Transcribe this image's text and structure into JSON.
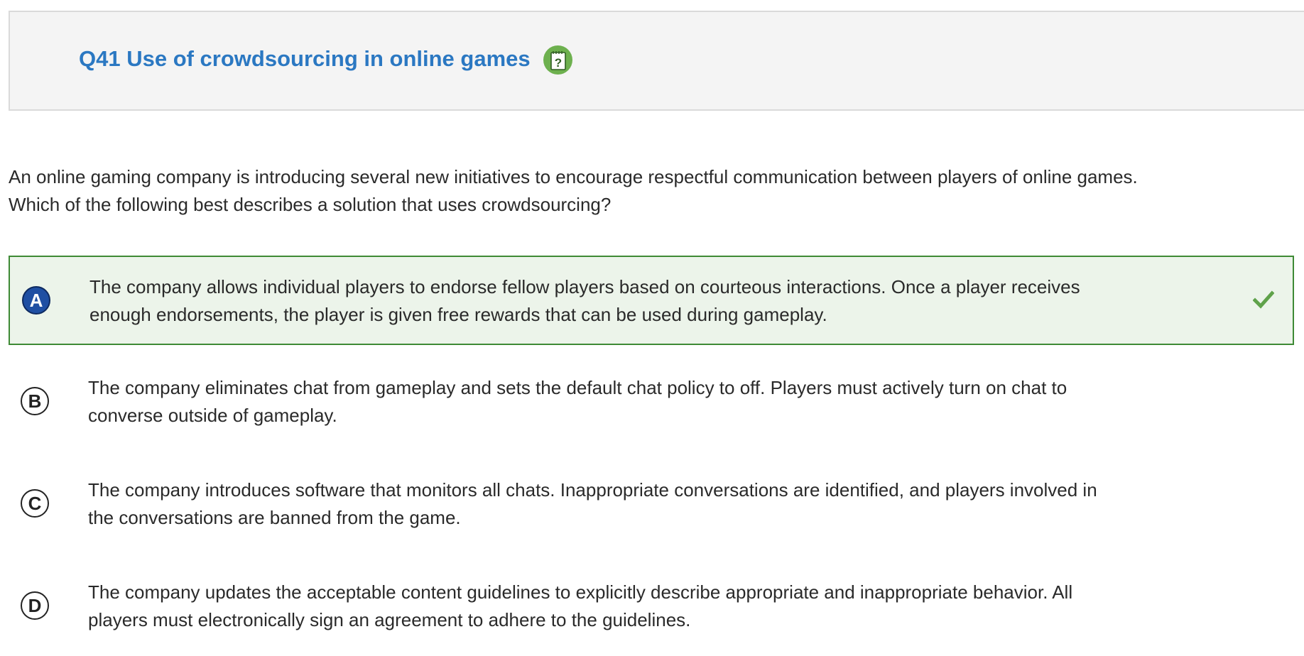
{
  "header": {
    "title": "Q41 Use of crowdsourcing in online games",
    "help_icon": "question-notepad-icon"
  },
  "question": {
    "line1": "An online gaming company is introducing several new initiatives to encourage respectful communication between players of online games.",
    "line2": "Which of the following best describes a solution that uses crowdsourcing?"
  },
  "options": [
    {
      "letter": "A",
      "text": "The company allows individual players to endorse fellow players based on courteous interactions. Once a player receives enough endorsements, the player is given free rewards that can be used during gameplay.",
      "selected": true,
      "correct": true
    },
    {
      "letter": "B",
      "text": "The company eliminates chat from gameplay and sets the default chat policy to off. Players must actively turn on chat to converse outside of gameplay.",
      "selected": false,
      "correct": false
    },
    {
      "letter": "C",
      "text": "The company introduces software that monitors all chats. Inappropriate conversations are identified, and players involved in the conversations are banned from the game.",
      "selected": false,
      "correct": false
    },
    {
      "letter": "D",
      "text": "The company updates the acceptable content guidelines to explicitly describe appropriate and inappropriate behavior. All players must electronically sign an agreement to adhere to the guidelines.",
      "selected": false,
      "correct": false
    }
  ],
  "colors": {
    "title": "#2b78c2",
    "correct_border": "#3e8a35",
    "correct_bg": "#ecf4ea",
    "check": "#5fa24a",
    "selected_badge": "#1f4fa3",
    "help_icon": "#6db04e"
  }
}
